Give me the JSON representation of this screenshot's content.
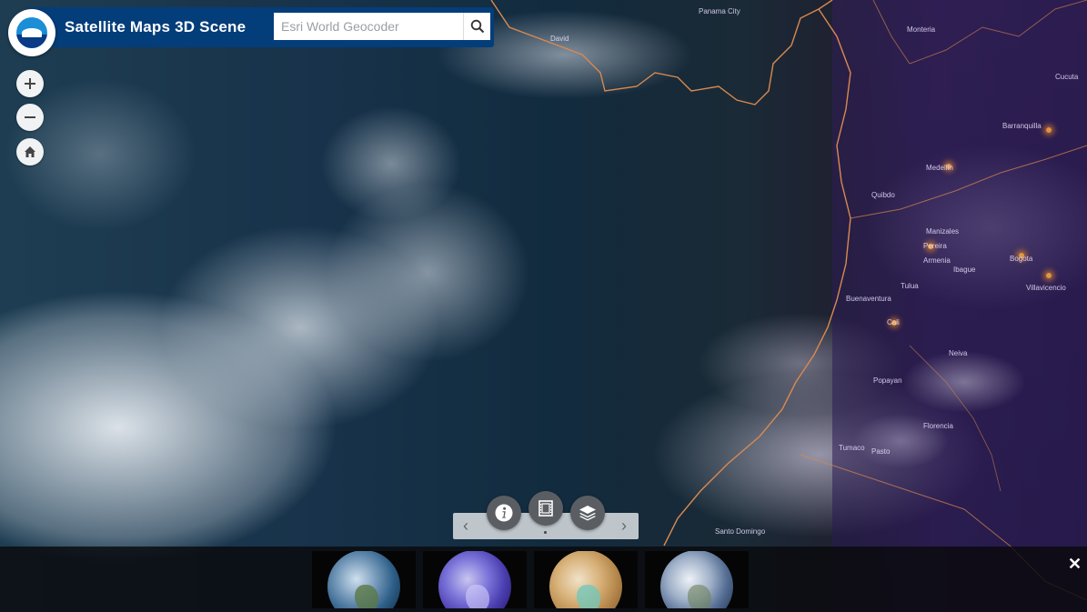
{
  "header": {
    "title": "Satellite Maps 3D Scene",
    "logo_icon": "noaa-logo-icon"
  },
  "search": {
    "placeholder": "Esri World Geocoder",
    "value": "",
    "button_icon": "search-icon"
  },
  "nav": {
    "zoom_in_icon": "plus-icon",
    "zoom_out_icon": "minus-icon",
    "home_icon": "home-icon"
  },
  "map_labels": [
    {
      "text": "Panama City"
    },
    {
      "text": "David"
    },
    {
      "text": "Monteria"
    },
    {
      "text": "Barranquilla"
    },
    {
      "text": "Cucuta"
    },
    {
      "text": "Medellin"
    },
    {
      "text": "Quibdo"
    },
    {
      "text": "Manizales"
    },
    {
      "text": "Pereira"
    },
    {
      "text": "Armenia"
    },
    {
      "text": "Ibague"
    },
    {
      "text": "Bogota"
    },
    {
      "text": "Villavicencio"
    },
    {
      "text": "Buenaventura"
    },
    {
      "text": "Tulua"
    },
    {
      "text": "Cali"
    },
    {
      "text": "Neiva"
    },
    {
      "text": "Popayan"
    },
    {
      "text": "Florencia"
    },
    {
      "text": "Pasto"
    },
    {
      "text": "Tumaco"
    },
    {
      "text": "Santo Domingo"
    }
  ],
  "carousel_controls": {
    "prev_icon": "chevron-left-icon",
    "next_icon": "chevron-right-icon",
    "info_icon": "info-icon",
    "gallery_icon": "film-strip-icon",
    "layers_icon": "layers-icon",
    "prev_glyph": "‹",
    "next_glyph": "›"
  },
  "gallery": {
    "items": [
      {
        "name": "true-color-globe-thumbnail"
      },
      {
        "name": "infrared-globe-thumbnail"
      },
      {
        "name": "water-vapor-globe-thumbnail"
      },
      {
        "name": "visible-globe-thumbnail"
      }
    ],
    "close_glyph": "✕"
  }
}
